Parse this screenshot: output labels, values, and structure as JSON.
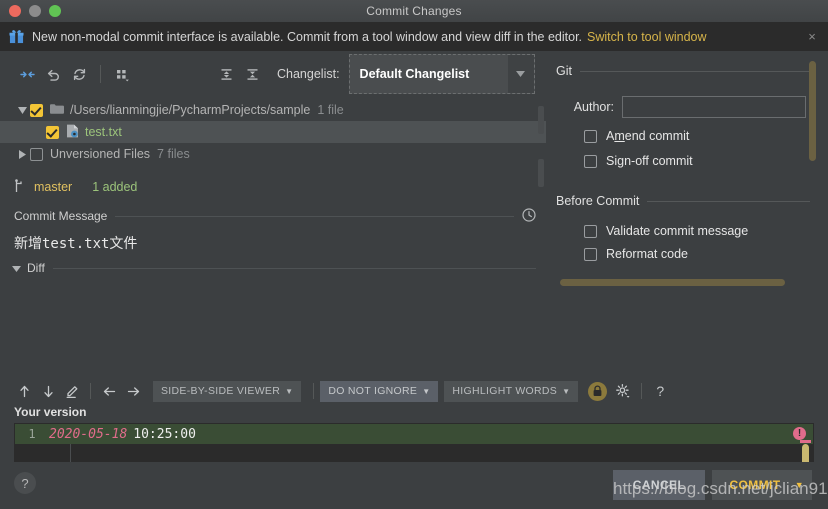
{
  "window": {
    "title": "Commit Changes",
    "traffic_lights": [
      "close",
      "minimize",
      "maximize"
    ]
  },
  "notification": {
    "icon": "gift-icon",
    "text": "New non-modal commit interface is available. Commit from a tool window and view diff in the editor.",
    "link": "Switch to tool window",
    "close": "×"
  },
  "toolbar": {
    "icons": [
      {
        "name": "collapse-selection-icon",
        "title": "Show Diff"
      },
      {
        "name": "rollback-icon",
        "title": "Revert"
      },
      {
        "name": "refresh-icon",
        "title": "Refresh"
      },
      {
        "name": "group-by-icon",
        "title": "Group By"
      },
      {
        "name": "expand-all-icon",
        "title": "Expand All"
      },
      {
        "name": "collapse-all-icon",
        "title": "Collapse All"
      }
    ],
    "changelist_label": "Changelist:",
    "changelist_value": "Default Changelist"
  },
  "tree": {
    "folder_row": {
      "path": "/Users/lianmingjie/PycharmProjects/sample",
      "count": "1 file",
      "checked": true,
      "expanded": true
    },
    "file_row": {
      "name": "test.txt",
      "checked": true,
      "selected": true
    },
    "unversioned_row": {
      "label": "Unversioned Files",
      "count": "7 files",
      "checked": false,
      "expanded": false
    }
  },
  "branch_bar": {
    "branch": "master",
    "status": "1 added"
  },
  "commit_message": {
    "section_title": "Commit Message",
    "history_icon": "clock-icon",
    "value": "新增test.txt文件"
  },
  "git_panel": {
    "group_title": "Git",
    "author_label": "Author:",
    "author_value": "",
    "options": [
      {
        "label": "Amend commit",
        "underline": "m",
        "checked": false
      },
      {
        "label": "Sign-off commit",
        "underline": "g",
        "checked": false
      }
    ],
    "before_commit_title": "Before Commit",
    "before_commit_options": [
      {
        "label": "Validate commit message",
        "checked": false
      },
      {
        "label": "Reformat code",
        "checked": false
      }
    ]
  },
  "diff": {
    "section_title": "Diff",
    "toolbar": {
      "icons": [
        {
          "name": "previous-difference-icon"
        },
        {
          "name": "next-difference-icon"
        },
        {
          "name": "edit-source-icon"
        },
        {
          "name": "accept-left-icon"
        },
        {
          "name": "accept-right-icon"
        }
      ],
      "viewer_mode": "SIDE-BY-SIDE VIEWER",
      "ignore_mode": "DO NOT IGNORE",
      "highlight_mode": "HIGHLIGHT WORDS",
      "lock_icon": "lock-icon",
      "settings_icon": "gear-icon",
      "help_icon": "?"
    },
    "pane_title": "Your version",
    "lines": [
      {
        "number": "1",
        "date": "2020-05-18",
        "time": "10:25:00"
      }
    ],
    "error_badge": "!"
  },
  "footer": {
    "help": "?",
    "cancel_label": "CANCEL",
    "commit_label": "COMMIT",
    "commit_arrow": "▼"
  },
  "watermark": "https://blog.csdn.net/jclian91",
  "colors": {
    "accent_yellow": "#f0c040",
    "added_green": "#9cc47b",
    "diff_added_bg": "#3a4d35",
    "date_pink": "#e06c8b",
    "link_gold": "#d6b44a"
  }
}
